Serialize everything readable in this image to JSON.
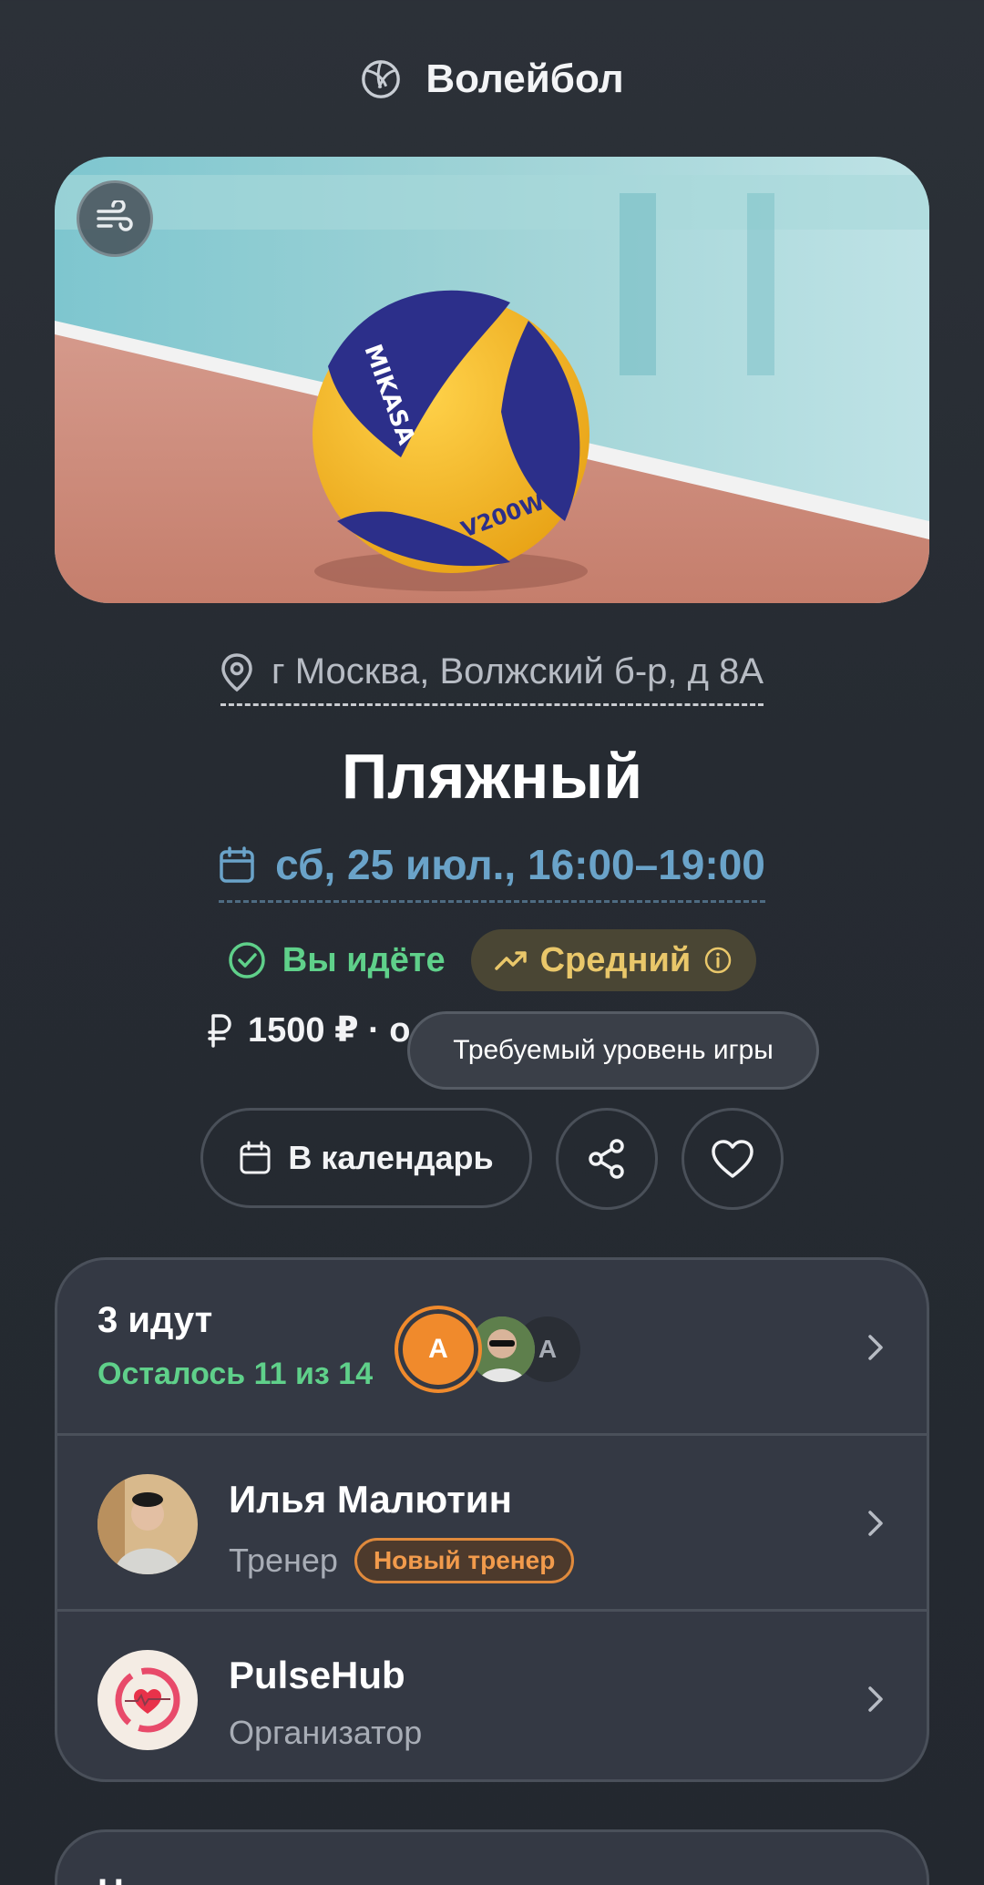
{
  "header": {
    "title": "Волейбол",
    "icon": "volleyball-icon"
  },
  "hero": {
    "image": "volleyball-photo",
    "badge_icon": "wind-icon"
  },
  "event": {
    "address": "г Москва, Волжский б-р, д 8А",
    "title": "Пляжный",
    "datetime": "сб, 25 июл., 16:00–19:00"
  },
  "status": {
    "going_label": "Вы идёте",
    "level_label": "Средний",
    "level_tooltip": "Требуемый уровень игры"
  },
  "price": {
    "text": "1500 ₽ · о"
  },
  "actions": {
    "calendar_label": "В календарь"
  },
  "participants": {
    "title": "3 идут",
    "subtitle": "Осталось 11 из 14",
    "avatar_main_initial": "А",
    "avatar_last_initial": "А"
  },
  "coach": {
    "name": "Илья Малютин",
    "role": "Тренер",
    "badge": "Новый тренер"
  },
  "organizer": {
    "name": "PulseHub",
    "role": "Организатор"
  },
  "next_section": {
    "peek": "Н"
  },
  "colors": {
    "background": "#282d34",
    "accent_blue": "#6aa3c9",
    "accent_green": "#5fd08a",
    "accent_yellow": "#e9c76a",
    "accent_orange": "#f08a2c"
  }
}
